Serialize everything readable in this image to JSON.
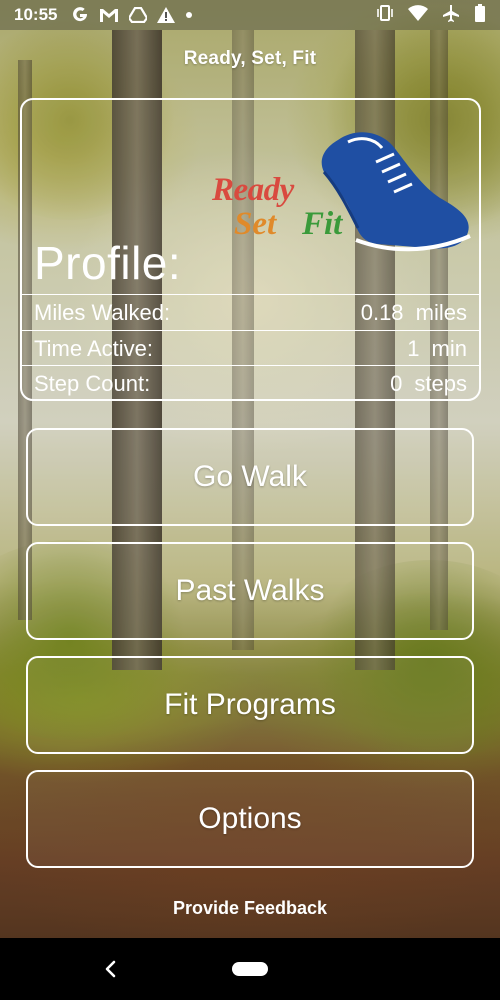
{
  "status_bar": {
    "time": "10:55",
    "left_icons": [
      "google-icon",
      "gmail-icon",
      "drive-icon",
      "alert-icon",
      "dot-icon"
    ],
    "right_icons": [
      "vibrate-icon",
      "wifi-icon",
      "airplane-icon",
      "battery-icon"
    ]
  },
  "app": {
    "title": "Ready, Set, Fit"
  },
  "logo": {
    "word1": "Ready",
    "word2": "Set",
    "word3": "Fit",
    "colors": {
      "ready": "#d94a3f",
      "set": "#e08a2a",
      "fit": "#3a9a3a",
      "shoe": "#1f4fa3"
    }
  },
  "profile": {
    "title": "Profile:",
    "stats": [
      {
        "label": "Miles Walked:",
        "value": "0.18 miles"
      },
      {
        "label": "Time Active:",
        "value": "1 min"
      },
      {
        "label": "Step Count:",
        "value": "0 steps"
      }
    ]
  },
  "menu": {
    "buttons": [
      {
        "label": "Go Walk"
      },
      {
        "label": "Past Walks"
      },
      {
        "label": "Fit Programs"
      },
      {
        "label": "Options"
      }
    ]
  },
  "footer": {
    "feedback_label": "Provide Feedback"
  },
  "system_nav": {
    "back_icon": "back-chevron-icon",
    "home_icon": "home-pill-icon"
  }
}
